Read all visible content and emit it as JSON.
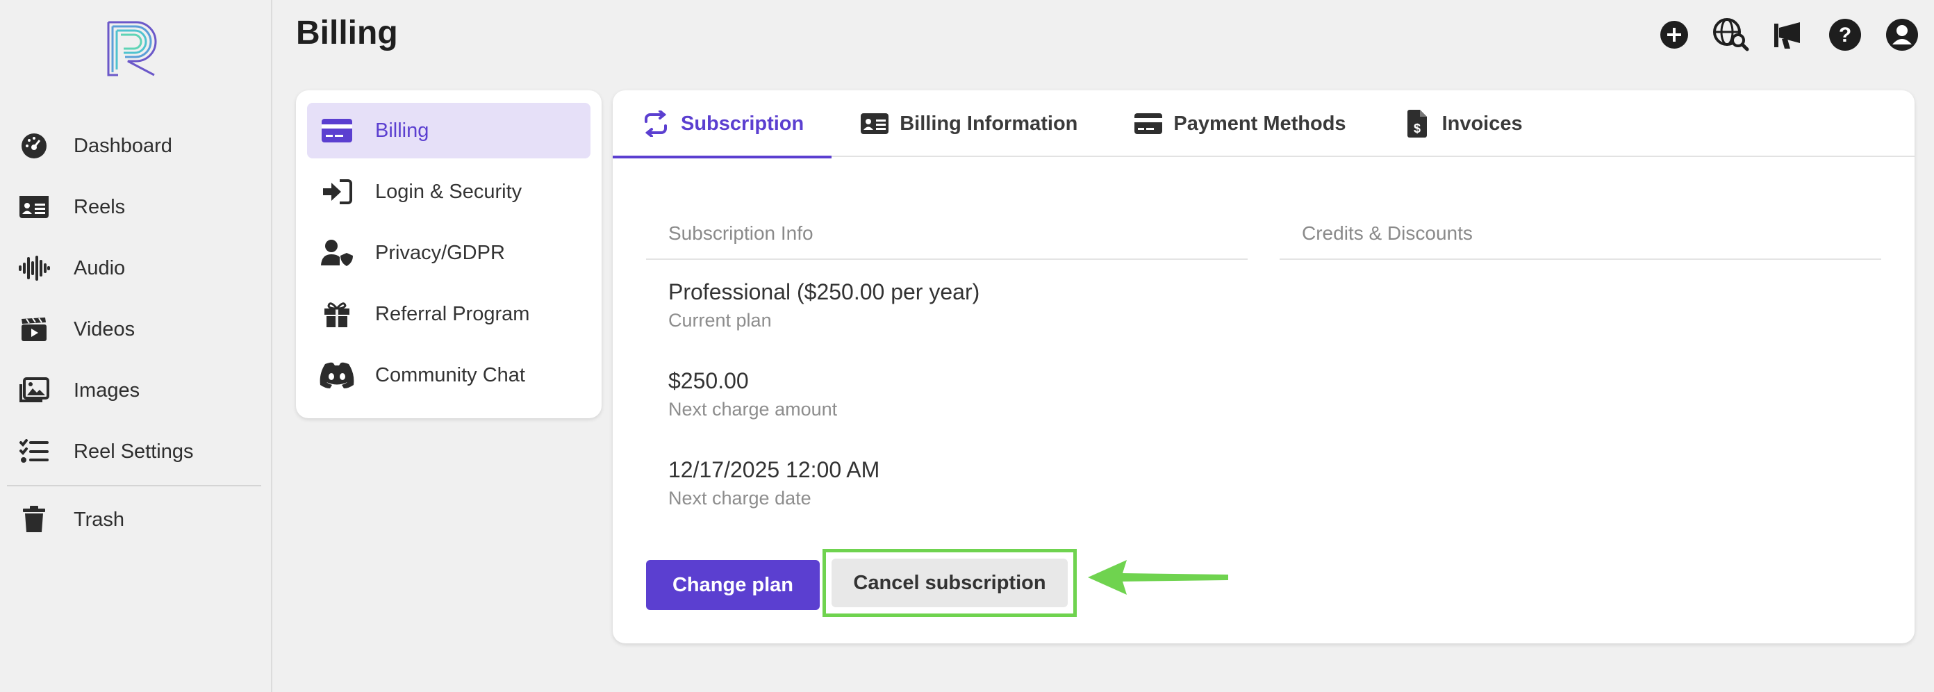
{
  "page": {
    "title": "Billing"
  },
  "sidebar": {
    "items": [
      {
        "label": "Dashboard",
        "icon": "dashboard-gauge-icon"
      },
      {
        "label": "Reels",
        "icon": "id-card-icon"
      },
      {
        "label": "Audio",
        "icon": "audio-waveform-icon"
      },
      {
        "label": "Videos",
        "icon": "clapperboard-icon"
      },
      {
        "label": "Images",
        "icon": "images-icon"
      },
      {
        "label": "Reel Settings",
        "icon": "checklist-icon"
      },
      {
        "label": "Trash",
        "icon": "trash-icon"
      }
    ]
  },
  "topbar": {
    "icons": [
      "add-icon",
      "globe-search-icon",
      "megaphone-icon",
      "help-icon",
      "account-icon"
    ]
  },
  "settings_nav": {
    "items": [
      {
        "label": "Billing",
        "icon": "credit-card-icon",
        "active": true
      },
      {
        "label": "Login & Security",
        "icon": "login-icon",
        "active": false
      },
      {
        "label": "Privacy/GDPR",
        "icon": "user-shield-icon",
        "active": false
      },
      {
        "label": "Referral Program",
        "icon": "gift-icon",
        "active": false
      },
      {
        "label": "Community Chat",
        "icon": "discord-icon",
        "active": false
      }
    ]
  },
  "tabs": [
    {
      "label": "Subscription",
      "icon": "refresh-arrows-icon",
      "active": true
    },
    {
      "label": "Billing Information",
      "icon": "address-card-icon",
      "active": false
    },
    {
      "label": "Payment Methods",
      "icon": "credit-card-icon",
      "active": false
    },
    {
      "label": "Invoices",
      "icon": "invoice-dollar-icon",
      "active": false
    }
  ],
  "subscription": {
    "info_heading": "Subscription Info",
    "credits_heading": "Credits & Discounts",
    "plan_value": "Professional ($250.00 per year)",
    "plan_label": "Current plan",
    "amount_value": "$250.00",
    "amount_label": "Next charge amount",
    "date_value": "12/17/2025 12:00 AM",
    "date_label": "Next charge date",
    "change_plan_label": "Change plan",
    "cancel_label": "Cancel subscription"
  },
  "colors": {
    "accent": "#5b3fd0",
    "active_bg": "#e6e0f8",
    "highlight": "#6fd34f"
  }
}
